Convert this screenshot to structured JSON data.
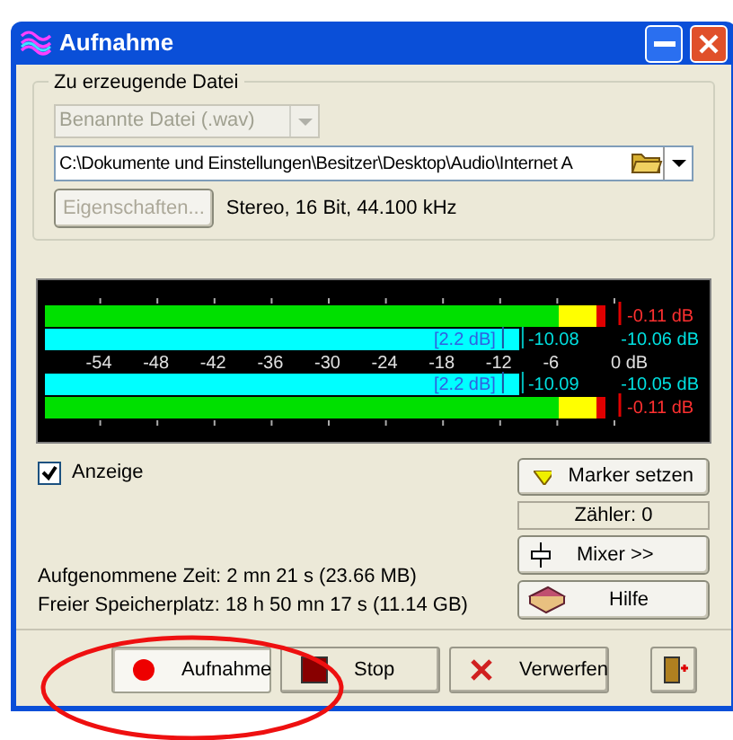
{
  "window": {
    "title": "Aufnahme"
  },
  "file_group": {
    "title": "Zu erzeugende Datei",
    "format_select": {
      "value": "Benannte Datei (.wav)",
      "disabled": true
    },
    "path_field": {
      "value": "C:\\Dokumente und Einstellungen\\Besitzer\\Desktop\\Audio\\Internet A"
    },
    "properties_button": {
      "label": "Eigenschaften...",
      "disabled": true
    },
    "format_info": "Stereo, 16 Bit, 44.100 kHz"
  },
  "meter": {
    "scale": [
      "-54",
      "-48",
      "-42",
      "-36",
      "-30",
      "-24",
      "-18",
      "-12",
      "-6",
      "0 dB"
    ],
    "channels": [
      {
        "peak": {
          "reading": "-0.11  dB"
        },
        "average": {
          "gain": "[2.2 dB]",
          "value": "-10.08",
          "reading": "-10.06 dB"
        }
      },
      {
        "peak": {
          "reading": "-0.11  dB"
        },
        "average": {
          "gain": "[2.2 dB]",
          "value": "-10.09",
          "reading": "-10.05 dB"
        }
      }
    ]
  },
  "display_checkbox": {
    "label": "Anzeige",
    "checked": true
  },
  "side_buttons": {
    "marker": "Marker setzen",
    "counter": "Zähler: 0",
    "mixer": "Mixer >>",
    "help": "Hilfe"
  },
  "stats": [
    "Aufgenommene Zeit: 2 mn 21 s (23.66 MB)",
    "Freier Speicherplatz: 18 h 50 mn 17 s (11.14 GB)"
  ],
  "bottom_buttons": [
    {
      "kind": "record",
      "label": "Aufnahme",
      "selected": true
    },
    {
      "kind": "stop",
      "label": "Stop",
      "selected": false
    },
    {
      "kind": "discard",
      "label": "Verwerfen",
      "selected": false
    },
    {
      "kind": "exit",
      "selected": false
    }
  ]
}
